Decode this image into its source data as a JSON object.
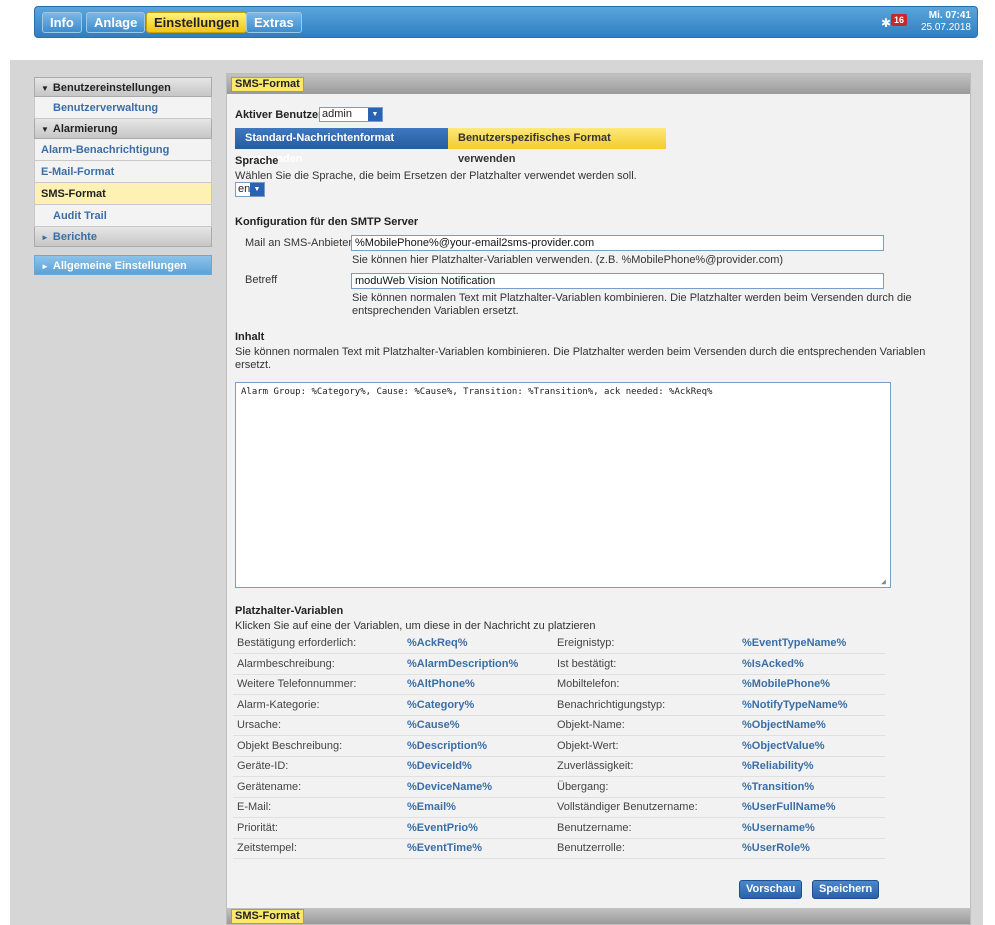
{
  "topnav": {
    "items": [
      {
        "label": "Info",
        "active": false
      },
      {
        "label": "Anlage",
        "active": false
      },
      {
        "label": "Einstellungen",
        "active": true
      },
      {
        "label": "Extras",
        "active": false
      }
    ],
    "alarm_count": "16",
    "clock_day": "Mi. 07:41",
    "clock_date": "25.07.2018"
  },
  "sidebar": {
    "group1_label": "Benutzereinstellungen",
    "item_users": "Benutzerverwaltung",
    "group2_label": "Alarmierung",
    "item_alarm_notify": "Alarm-Benachrichtigung",
    "item_email_format": "E-Mail-Format",
    "item_sms_format": "SMS-Format",
    "item_audit": "Audit Trail",
    "group3_label": "Berichte",
    "group4_label": "Allgemeine Einstellungen"
  },
  "panel": {
    "title": "SMS-Format",
    "active_user_label": "Aktiver Benutzer:",
    "active_user_value": "admin",
    "btn_standard": "Standard-Nachrichtenformat verwenden",
    "btn_custom": "Benutzerspezifisches Format verwenden",
    "language_heading": "Sprache",
    "language_desc": "Wählen Sie die Sprache, die beim Ersetzen der Platzhalter verwendet werden soll.",
    "language_value": "en",
    "smtp_heading": "Konfiguration für den SMTP Server",
    "mail_label": "Mail an SMS-Anbieter",
    "mail_value": "%MobilePhone%@your-email2sms-provider.com",
    "mail_hint": "Sie können hier Platzhalter-Variablen verwenden. (z.B. %MobilePhone%@provider.com)",
    "subject_label": "Betreff",
    "subject_value": "moduWeb Vision Notification",
    "subject_hint1": "Sie können normalen Text mit Platzhalter-Variablen kombinieren. Die Platzhalter werden beim Versenden durch die",
    "subject_hint2": "entsprechenden Variablen ersetzt.",
    "content_heading": "Inhalt",
    "content_desc1": "Sie können normalen Text mit Platzhalter-Variablen kombinieren. Die Platzhalter werden beim Versenden durch die entsprechenden Variablen",
    "content_desc2": "ersetzt.",
    "content_value": "Alarm Group: %Category%, Cause: %Cause%, Transition: %Transition%, ack needed: %AckReq%",
    "vars_heading": "Platzhalter-Variablen",
    "vars_desc": "Klicken Sie auf eine der Variablen, um diese in der Nachricht zu platzieren",
    "btn_preview": "Vorschau",
    "btn_save": "Speichern"
  },
  "variables": [
    [
      "Bestätigung erforderlich:",
      "%AckReq%",
      "Ereignistyp:",
      "%EventTypeName%"
    ],
    [
      "Alarmbeschreibung:",
      "%AlarmDescription%",
      "Ist bestätigt:",
      "%IsAcked%"
    ],
    [
      "Weitere Telefonnummer:",
      "%AltPhone%",
      "Mobiltelefon:",
      "%MobilePhone%"
    ],
    [
      "Alarm-Kategorie:",
      "%Category%",
      "Benachrichtigungstyp:",
      "%NotifyTypeName%"
    ],
    [
      "Ursache:",
      "%Cause%",
      "Objekt-Name:",
      "%ObjectName%"
    ],
    [
      "Objekt Beschreibung:",
      "%Description%",
      "Objekt-Wert:",
      "%ObjectValue%"
    ],
    [
      "Geräte-ID:",
      "%DeviceId%",
      "Zuverlässigkeit:",
      "%Reliability%"
    ],
    [
      "Gerätename:",
      "%DeviceName%",
      "Übergang:",
      "%Transition%"
    ],
    [
      "E-Mail:",
      "%Email%",
      "Vollständiger Benutzername:",
      "%UserFullName%"
    ],
    [
      "Priorität:",
      "%EventPrio%",
      "Benutzername:",
      "%Username%"
    ],
    [
      "Zeitstempel:",
      "%EventTime%",
      "Benutzerrolle:",
      "%UserRole%"
    ]
  ]
}
